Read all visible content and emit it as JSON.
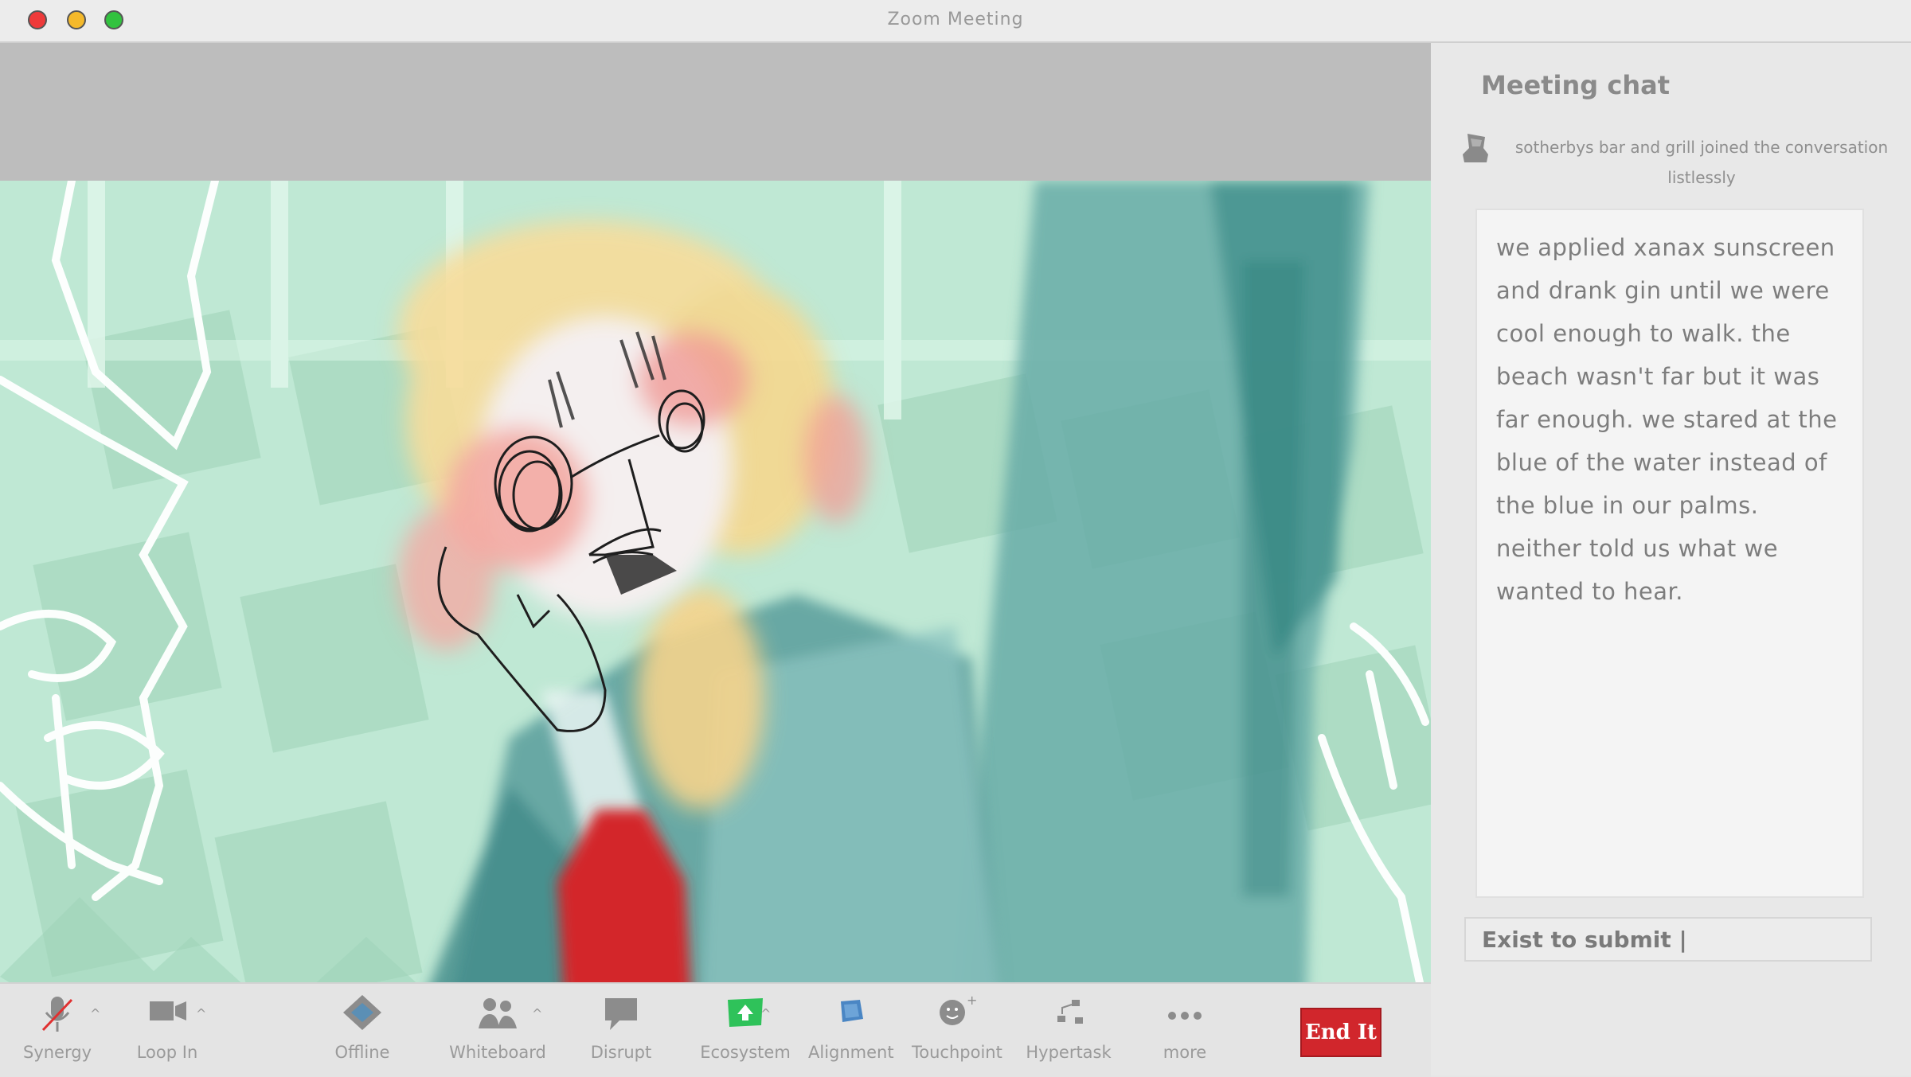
{
  "window": {
    "title": "Zoom Meeting"
  },
  "chat": {
    "title": "Meeting chat",
    "join_notice": "sotherbys bar and grill  joined the conversation listlessly",
    "message": "we applied xanax sunscreen and drank gin until we were cool enough to walk. the beach wasn't far but it was far enough. we stared at the blue of the water instead of the blue in our palms. neither told us what we wanted to hear.",
    "input_text": "Exist to submit |"
  },
  "toolbar": {
    "items": [
      {
        "label": "Synergy",
        "icon": "muted-mic-icon"
      },
      {
        "label": "Loop In",
        "icon": "video-camera-icon"
      },
      {
        "label": "Offline",
        "icon": "shield-diamond-icon"
      },
      {
        "label": "Whiteboard",
        "icon": "participants-icon"
      },
      {
        "label": "Disrupt",
        "icon": "chat-bubble-icon"
      },
      {
        "label": "Ecosystem",
        "icon": "share-screen-icon"
      },
      {
        "label": "Alignment",
        "icon": "record-icon"
      },
      {
        "label": "Touchpoint",
        "icon": "reactions-icon"
      },
      {
        "label": "Hypertask",
        "icon": "breakout-icon"
      },
      {
        "label": "more",
        "icon": "more-dots-icon"
      }
    ],
    "end_label": "End It"
  },
  "colors": {
    "end_button": "#d1262c",
    "share_green": "#2fc25a",
    "mint_bg": "#bfe8d4",
    "teal": "#5aa4a0"
  }
}
